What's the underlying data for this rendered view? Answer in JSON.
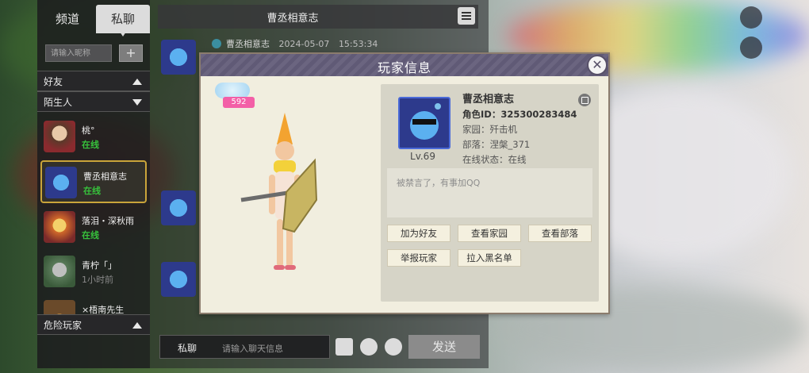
{
  "tabs": {
    "channel": "频道",
    "private": "私聊"
  },
  "nick_input": {
    "placeholder": "请输入昵称"
  },
  "add_button": "+",
  "sections": {
    "friends": "好友",
    "strangers": "陌生人",
    "danger": "危险玩家"
  },
  "contacts": [
    {
      "name": "桃°",
      "status": "在线",
      "online": true
    },
    {
      "name": "曹丞相意志",
      "status": "在线",
      "online": true,
      "selected": true
    },
    {
      "name": "落泪・深秋雨",
      "status": "在线",
      "online": true
    },
    {
      "name": "青柠「」",
      "status": "1小时前",
      "online": false
    },
    {
      "name": "×梧南先生",
      "status": "",
      "online": false
    }
  ],
  "chat": {
    "title": "曹丞相意志",
    "message": {
      "sender": "曹丞相意志",
      "date": "2024-05-07",
      "time": "15:53:34"
    },
    "input_mode": "私聊",
    "input_placeholder": "请输入聊天信息",
    "send_label": "发送"
  },
  "dialog": {
    "title": "玩家信息",
    "close": "✕",
    "badge_value": "592",
    "player": {
      "name": "曹丞相意志",
      "role_id": "角色ID：325300283484",
      "home": "家园：歼击机",
      "tribe": "部落：涅槃_371",
      "online_status": "在线状态：在线",
      "level": "Lv.69",
      "signature": "被禁言了，有事加QQ"
    },
    "buttons": {
      "add_friend": "加为好友",
      "view_home": "查看家园",
      "view_tribe": "查看部落",
      "report": "举报玩家",
      "blacklist": "拉入黑名单"
    }
  },
  "colors": {
    "online": "#37c23c",
    "accent_gold": "#c9a43a",
    "badge_pink": "#f35fa7",
    "title_bar": "#6b6580"
  }
}
